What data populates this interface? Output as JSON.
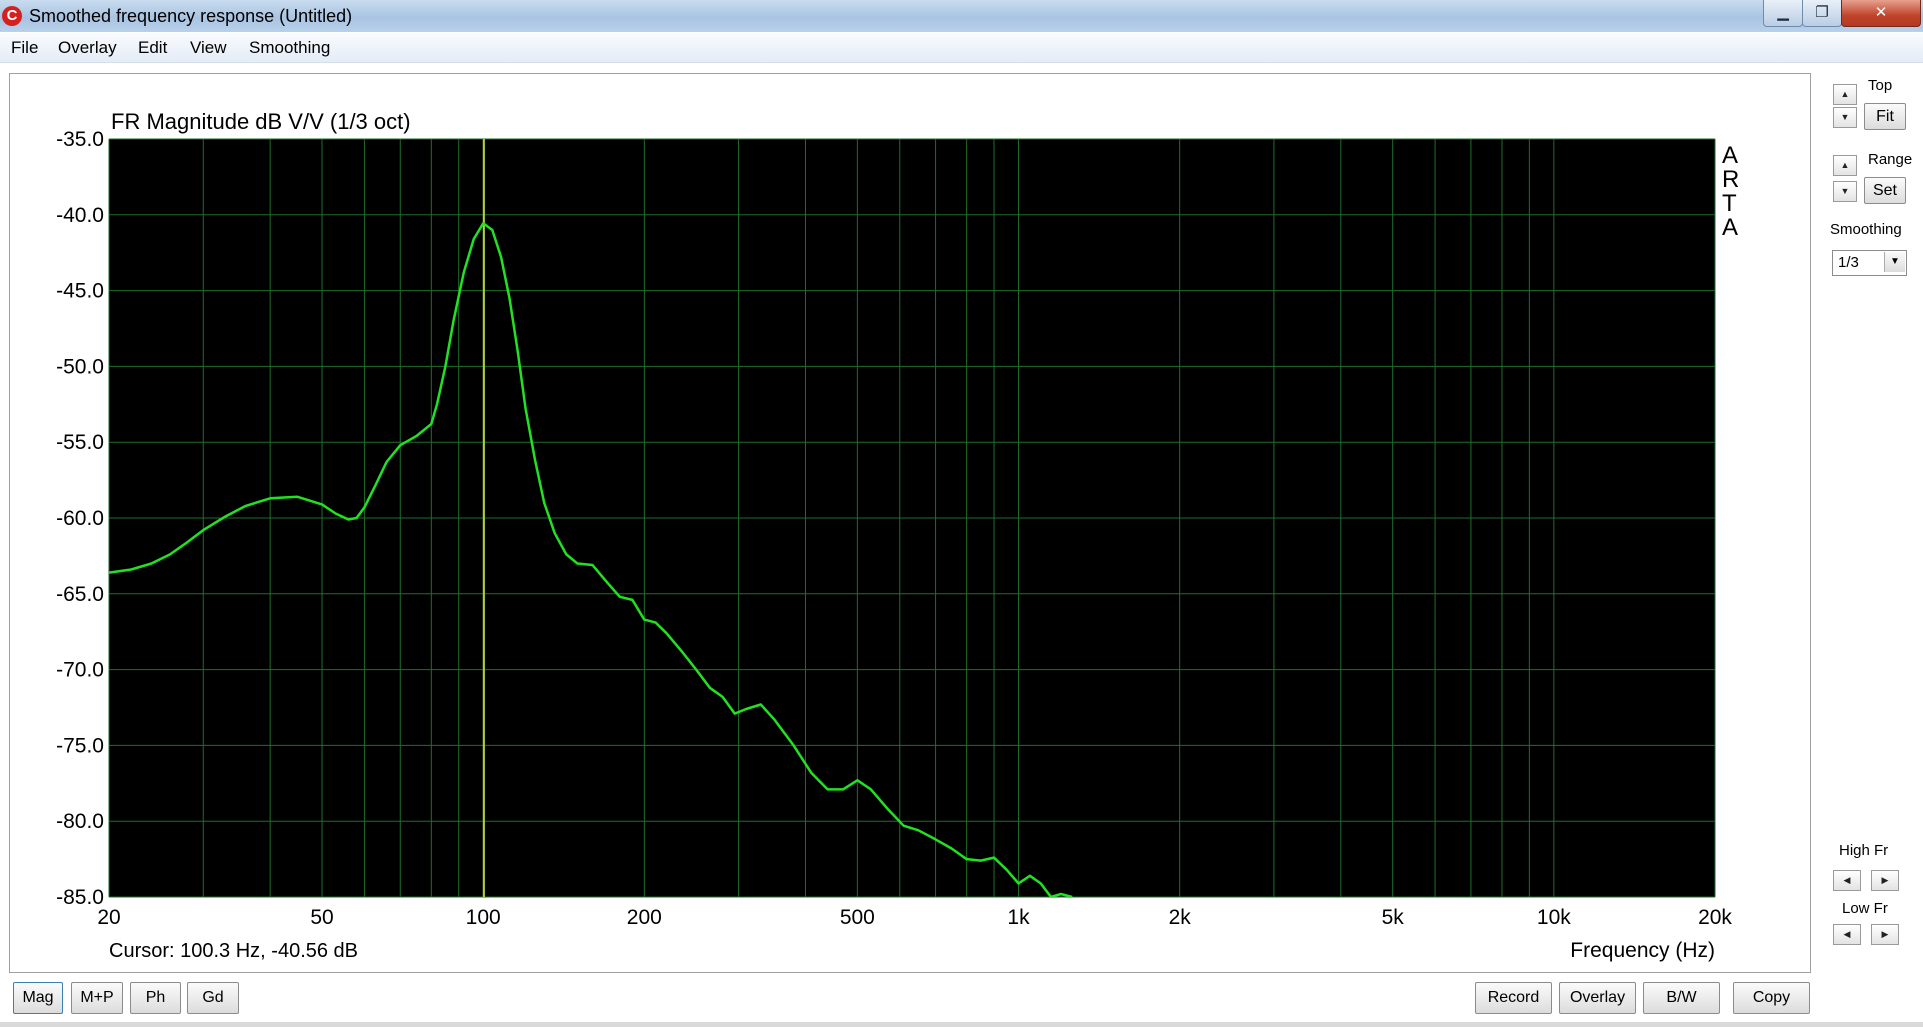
{
  "window": {
    "title": "Smoothed frequency response (Untitled)",
    "icon_letter": "C",
    "min_glyph": "▁",
    "max_glyph": "❐",
    "close_glyph": "✕"
  },
  "menu": [
    "File",
    "Overlay",
    "Edit",
    "View",
    "Smoothing"
  ],
  "chart_data": {
    "type": "line",
    "title": "FR Magnitude dB V/V (1/3 oct)",
    "xlabel": "Frequency (Hz)",
    "ylabel": "",
    "xscale": "log",
    "xlim": [
      20,
      20000
    ],
    "ylim": [
      -85,
      -35
    ],
    "yticks": [
      "-35.0",
      "-40.0",
      "-45.0",
      "-50.0",
      "-55.0",
      "-60.0",
      "-65.0",
      "-70.0",
      "-75.0",
      "-80.0",
      "-85.0"
    ],
    "xticks": [
      {
        "value": 20,
        "label": "20"
      },
      {
        "value": 50,
        "label": "50"
      },
      {
        "value": 100,
        "label": "100"
      },
      {
        "value": 200,
        "label": "200"
      },
      {
        "value": 500,
        "label": "500"
      },
      {
        "value": 1000,
        "label": "1k"
      },
      {
        "value": 2000,
        "label": "2k"
      },
      {
        "value": 5000,
        "label": "5k"
      },
      {
        "value": 10000,
        "label": "10k"
      },
      {
        "value": 20000,
        "label": "20k"
      }
    ],
    "grid": true,
    "background": "#000000",
    "grid_color": "#1f6e2a",
    "line_color": "#22e022",
    "cursor_color": "#b8cf3a",
    "cursor_x": 100.3,
    "cursor_text": "Cursor: 100.3 Hz, -40.56 dB",
    "watermark": [
      "A",
      "R",
      "T",
      "A"
    ],
    "series": [
      {
        "x": [
          20,
          22,
          24,
          26,
          28,
          30,
          33,
          36,
          40,
          45,
          50,
          53,
          56,
          58,
          60,
          63,
          66,
          70,
          75,
          80,
          82,
          85,
          88,
          92,
          96,
          100,
          104,
          108,
          112,
          116,
          120,
          125,
          130,
          136,
          143,
          150,
          160,
          170,
          180,
          190,
          200,
          210,
          220,
          235,
          250,
          265,
          280,
          295,
          310,
          330,
          350,
          380,
          410,
          440,
          470,
          500,
          530,
          570,
          610,
          650,
          700,
          750,
          800,
          850,
          900,
          950,
          1000,
          1050,
          1100,
          1150,
          1200,
          1260
        ],
        "y": [
          -63.6,
          -63.4,
          -63.0,
          -62.4,
          -61.6,
          -60.8,
          -59.9,
          -59.2,
          -58.7,
          -58.6,
          -59.1,
          -59.7,
          -60.1,
          -60.0,
          -59.3,
          -57.8,
          -56.3,
          -55.2,
          -54.6,
          -53.8,
          -52.5,
          -50.0,
          -47.0,
          -43.8,
          -41.6,
          -40.56,
          -41.0,
          -42.8,
          -45.5,
          -49.0,
          -52.8,
          -56.2,
          -59.0,
          -61.0,
          -62.4,
          -63.0,
          -63.1,
          -64.2,
          -65.2,
          -65.4,
          -66.7,
          -66.9,
          -67.6,
          -68.8,
          -70.0,
          -71.2,
          -71.8,
          -72.9,
          -72.6,
          -72.3,
          -73.3,
          -75.0,
          -76.8,
          -77.9,
          -77.9,
          -77.3,
          -77.9,
          -79.2,
          -80.3,
          -80.6,
          -81.2,
          -81.8,
          -82.5,
          -82.6,
          -82.4,
          -83.2,
          -84.1,
          -83.6,
          -84.1,
          -85.0,
          -84.8,
          -85.0
        ]
      }
    ]
  },
  "right_panel": {
    "top_label": "Top",
    "fit_label": "Fit",
    "range_label": "Range",
    "set_label": "Set",
    "smoothing_label": "Smoothing",
    "smoothing_value": "1/3",
    "high_fr_label": "High Fr",
    "low_fr_label": "Low Fr",
    "up_glyph": "▲",
    "down_glyph": "▼",
    "left_glyph": "◀",
    "right_glyph": "▶"
  },
  "bottom": {
    "left_buttons": [
      "Mag",
      "M+P",
      "Ph",
      "Gd"
    ],
    "right_buttons": [
      "Record",
      "Overlay",
      "B/W",
      "Copy"
    ]
  }
}
